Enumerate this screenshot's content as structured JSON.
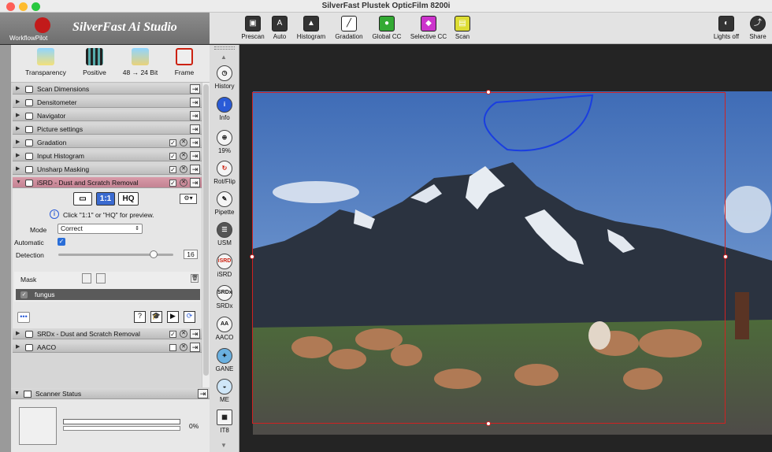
{
  "window": {
    "title": "SilverFast  Plustek OpticFilm 8200i"
  },
  "brand": {
    "workflow_label": "WorkflowPilot",
    "app_name": "SilverFast Ai Studio"
  },
  "toolbar": {
    "buttons": [
      {
        "label": "Prescan",
        "icon": "prescan-icon"
      },
      {
        "label": "Auto",
        "icon": "auto-icon"
      },
      {
        "label": "Histogram",
        "icon": "histogram-icon"
      },
      {
        "label": "Gradation",
        "icon": "gradation-icon"
      },
      {
        "label": "Global CC",
        "icon": "global-cc-icon"
      },
      {
        "label": "Selective CC",
        "icon": "selective-cc-icon"
      },
      {
        "label": "Scan",
        "icon": "scan-icon"
      }
    ],
    "right_buttons": [
      {
        "label": "Lights off",
        "icon": "lights-off-icon"
      },
      {
        "label": "Share",
        "icon": "share-icon"
      }
    ]
  },
  "modes": [
    {
      "label": "Transparency"
    },
    {
      "label": "Positive"
    },
    {
      "label": "48 → 24 Bit"
    },
    {
      "label": "Frame"
    }
  ],
  "panels": [
    {
      "label": "Scan Dimensions"
    },
    {
      "label": "Densitometer"
    },
    {
      "label": "Navigator"
    },
    {
      "label": "Picture settings"
    },
    {
      "label": "Gradation",
      "checked": true
    },
    {
      "label": "Input Histogram",
      "checked": true
    },
    {
      "label": "Unsharp Masking",
      "checked": true
    },
    {
      "label": "iSRD - Dust and Scratch Removal",
      "checked": true,
      "expanded": true
    }
  ],
  "isrd": {
    "view_buttons": [
      "",
      "1:1",
      "HQ"
    ],
    "hint": "Click \"1:1\" or \"HQ\" for preview.",
    "mode_label": "Mode",
    "mode_value": "Correct",
    "automatic_label": "Automatic",
    "automatic_checked": true,
    "detection_label": "Detection",
    "detection_value": "16",
    "detection_fraction": 0.85,
    "mask_label": "Mask",
    "mask_items": [
      {
        "label": "fungus",
        "selected": true
      }
    ]
  },
  "panels_after": [
    {
      "label": "SRDx - Dust and Scratch Removal",
      "checked": true
    },
    {
      "label": "AACO",
      "checked": false
    }
  ],
  "scanner_status": {
    "label": "Scanner Status",
    "progress_text": "0%",
    "progress": 0
  },
  "vertical_tools": [
    {
      "label": "History",
      "icon": "history-icon"
    },
    {
      "label": "Info",
      "icon": "info-icon"
    },
    {
      "label": "19%",
      "icon": "zoom-icon"
    },
    {
      "label": "Rot/Flip",
      "icon": "rotate-flip-icon"
    },
    {
      "label": "Pipette",
      "icon": "pipette-icon"
    },
    {
      "label": "USM",
      "icon": "usm-icon"
    },
    {
      "label": "iSRD",
      "icon": "isrd-icon"
    },
    {
      "label": "SRDx",
      "icon": "srdx-icon"
    },
    {
      "label": "AACO",
      "icon": "aaco-icon"
    },
    {
      "label": "GANE",
      "icon": "gane-icon"
    },
    {
      "label": "ME",
      "icon": "me-icon"
    },
    {
      "label": "IT8",
      "icon": "it8-icon"
    }
  ],
  "colors": {
    "accent_red": "#d02121",
    "mask_outline": "#1a3ee0",
    "active_row": "#c8899a"
  }
}
